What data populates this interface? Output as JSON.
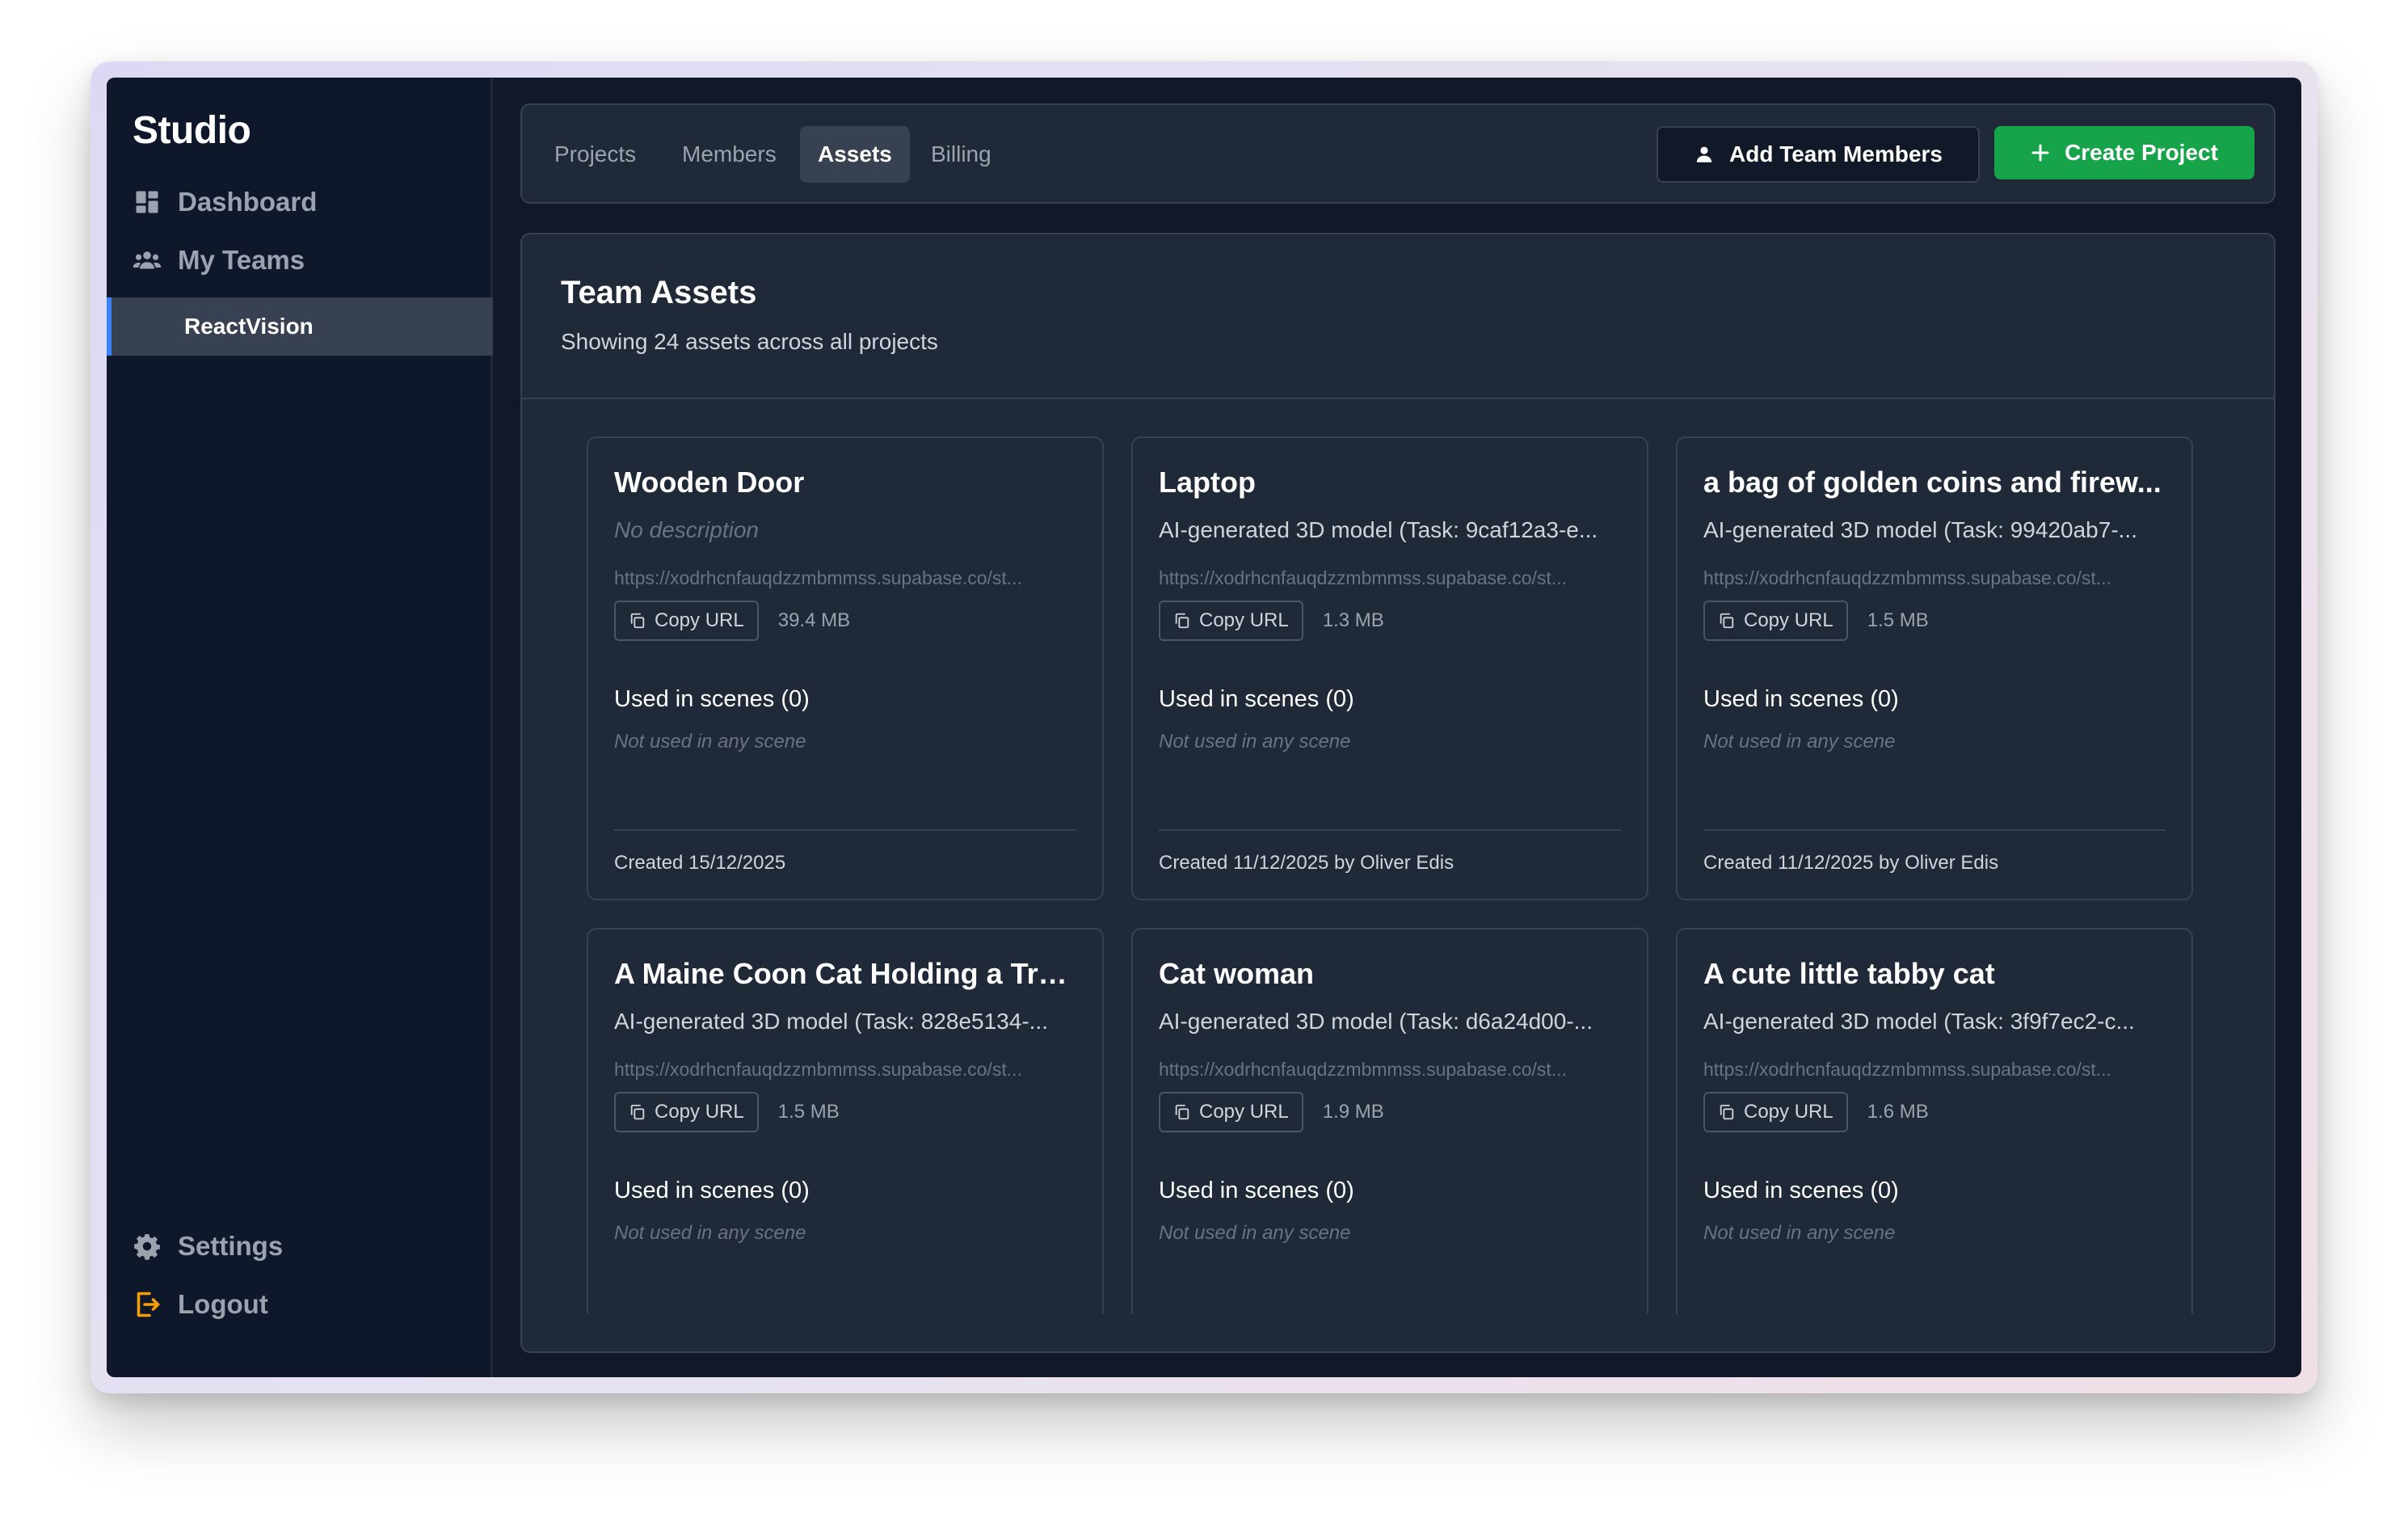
{
  "sidebar": {
    "brand": "Studio",
    "items": [
      {
        "label": "Dashboard"
      },
      {
        "label": "My Teams"
      }
    ],
    "sub_item": "ReactVision",
    "bottom": [
      {
        "label": "Settings"
      },
      {
        "label": "Logout"
      }
    ]
  },
  "tabs": [
    {
      "label": "Projects",
      "active": false
    },
    {
      "label": "Members",
      "active": false
    },
    {
      "label": "Assets",
      "active": true
    },
    {
      "label": "Billing",
      "active": false
    }
  ],
  "actions": {
    "add_members": "Add Team Members",
    "create_project": "Create Project"
  },
  "content": {
    "title": "Team Assets",
    "subtitle": "Showing 24 assets across all projects"
  },
  "labels": {
    "copy_url": "Copy URL",
    "used_in_scenes": "Used in scenes (0)",
    "not_used": "Not used in any scene"
  },
  "assets": [
    {
      "title": "Wooden Door",
      "description": "No description",
      "url": "https://xodrhcnfauqdzzmbmmss.supabase.co/st...",
      "size": "39.4 MB",
      "created": "Created 15/12/2025"
    },
    {
      "title": "Laptop",
      "description": "AI-generated 3D model (Task: 9caf12a3-e...",
      "url": "https://xodrhcnfauqdzzmbmmss.supabase.co/st...",
      "size": "1.3 MB",
      "created": "Created 11/12/2025 by Oliver Edis"
    },
    {
      "title": "a bag of golden coins and firew...",
      "description": "AI-generated 3D model (Task: 99420ab7-...",
      "url": "https://xodrhcnfauqdzzmbmmss.supabase.co/st...",
      "size": "1.5 MB",
      "created": "Created 11/12/2025 by Oliver Edis"
    },
    {
      "title": "A Maine Coon Cat Holding a Tro...",
      "description": "AI-generated 3D model (Task: 828e5134-...",
      "url": "https://xodrhcnfauqdzzmbmmss.supabase.co/st...",
      "size": "1.5 MB",
      "created": ""
    },
    {
      "title": "Cat woman",
      "description": "AI-generated 3D model (Task: d6a24d00-...",
      "url": "https://xodrhcnfauqdzzmbmmss.supabase.co/st...",
      "size": "1.9 MB",
      "created": ""
    },
    {
      "title": "A cute little tabby cat",
      "description": "AI-generated 3D model (Task: 3f9f7ec2-c...",
      "url": "https://xodrhcnfauqdzzmbmmss.supabase.co/st...",
      "size": "1.6 MB",
      "created": ""
    }
  ],
  "colors": {
    "accent_blue": "#3b82f6",
    "create_green": "#16a34a",
    "logout_orange": "#f59e0b"
  }
}
